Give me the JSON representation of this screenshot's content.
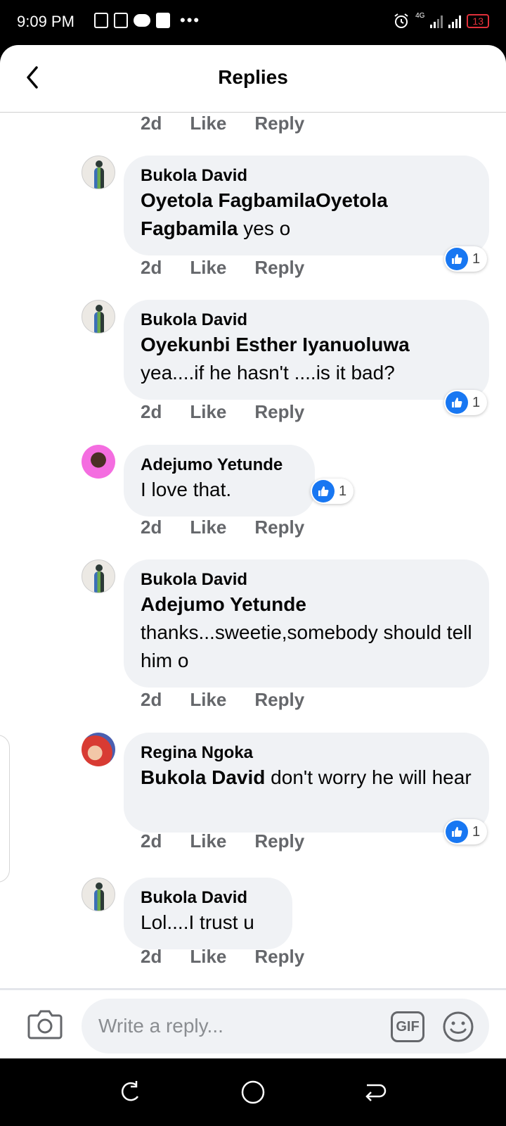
{
  "status_bar": {
    "time": "9:09 PM",
    "dots": "•••",
    "network_label": "4G",
    "battery": "13"
  },
  "header": {
    "title": "Replies",
    "back_icon": "chevron-left-icon"
  },
  "comments": [
    {
      "author": "Bukola David",
      "mention": "Oyetola FagbamilaOyetola Fagbamila",
      "text": " yes o",
      "likes": "1",
      "actions": {
        "time": "2d",
        "like": "Like",
        "reply": "Reply"
      }
    },
    {
      "author": "Bukola David",
      "mention": "Oyekunbi Esther Iyanuoluwa",
      "text": "yea....if he hasn't ....is it bad?",
      "likes": "1",
      "actions": {
        "time": "2d",
        "like": "Like",
        "reply": "Reply"
      }
    },
    {
      "author": "Adejumo Yetunde",
      "mention": "",
      "text": "I love that.",
      "likes": "1",
      "actions": {
        "time": "2d",
        "like": "Like",
        "reply": "Reply"
      }
    },
    {
      "author": "Bukola David",
      "mention": "Adejumo Yetunde",
      "text": "thanks...sweetie,somebody should tell him o",
      "likes": "",
      "actions": {
        "time": "2d",
        "like": "Like",
        "reply": "Reply"
      }
    },
    {
      "author": "Regina Ngoka",
      "mention": "Bukola David",
      "text": " don't worry he will hear",
      "likes": "1",
      "actions": {
        "time": "2d",
        "like": "Like",
        "reply": "Reply"
      }
    },
    {
      "author": "Bukola David",
      "mention": "",
      "text": "Lol....I trust u",
      "likes": "",
      "actions": {
        "time": "2d",
        "like": "Like",
        "reply": "Reply"
      }
    }
  ],
  "top_actions": {
    "time": "2d",
    "like": "Like",
    "reply": "Reply"
  },
  "composer": {
    "placeholder": "Write a reply...",
    "gif_label": "GIF"
  },
  "colors": {
    "like_blue": "#1877f2",
    "bubble_bg": "#f0f2f5",
    "meta_gray": "#65676b"
  }
}
